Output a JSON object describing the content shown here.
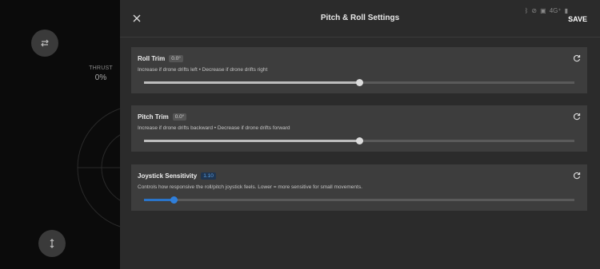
{
  "background": {
    "thrust_label": "THRUST",
    "thrust_value": "0%"
  },
  "status_bar": {
    "network": "4G⁺"
  },
  "header": {
    "title": "Pitch & Roll Settings",
    "save_label": "SAVE"
  },
  "cards": [
    {
      "title": "Roll Trim",
      "badge": "0.0°",
      "description": "Increase if drone drifts left • Decrease if drone drifts right",
      "slider_value": 0.5
    },
    {
      "title": "Pitch Trim",
      "badge": "0.0°",
      "description": "Increase if drone drifts backward • Decrease if drone drifts forward",
      "slider_value": 0.5
    },
    {
      "title": "Joystick Sensitivity",
      "badge": "1.10",
      "description": "Controls how responsive the roll/pitch joystick feels. Lower = more sensitive for small movements.",
      "slider_value": 0.07,
      "accent": "#2f7fdb"
    }
  ]
}
